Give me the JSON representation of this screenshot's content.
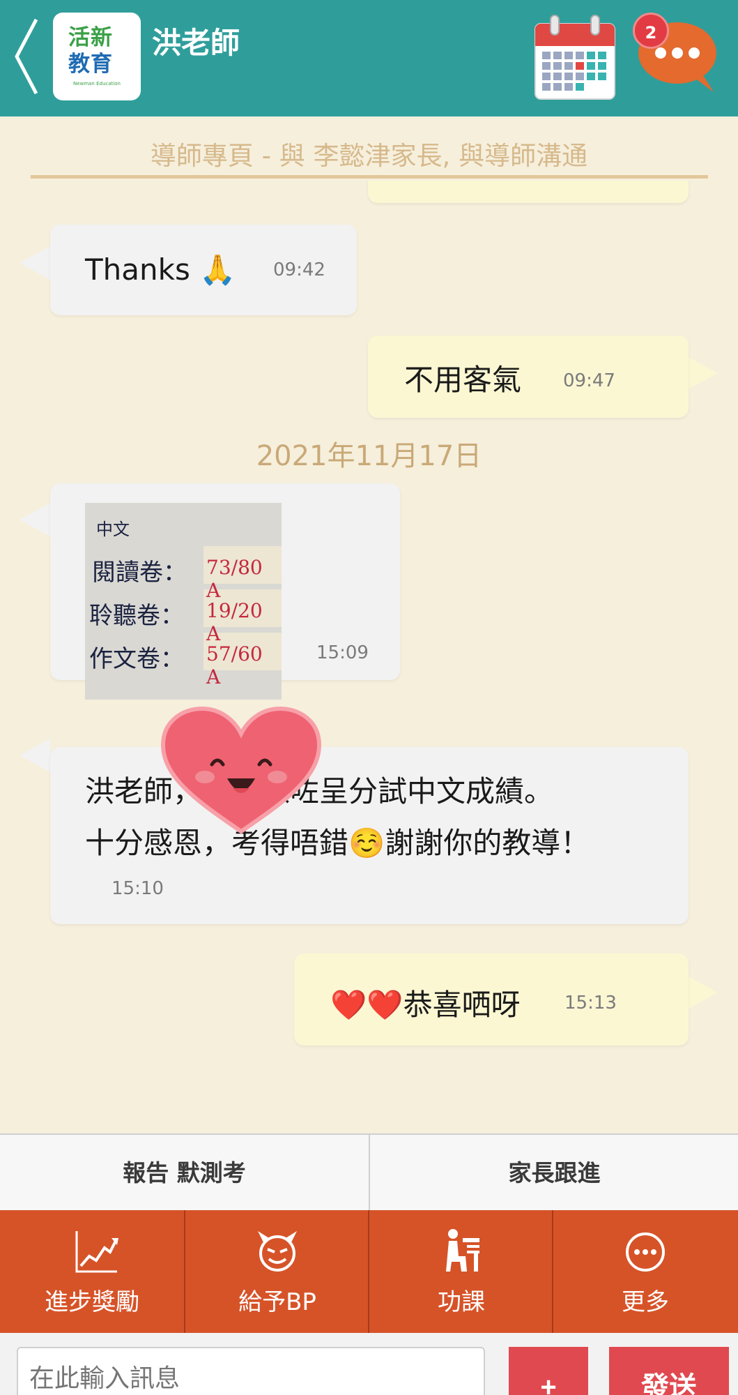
{
  "header": {
    "title": "洪老師",
    "logo_line1": "活新",
    "logo_line2": "教育",
    "logo_caption": "Newman Education",
    "notification_count": "2"
  },
  "subheader": {
    "text": "導師專頁 - 與 李懿津家長, 與導師溝通"
  },
  "messages": [
    {
      "direction": "in",
      "text": "Thanks 🙏",
      "time": "09:42"
    },
    {
      "direction": "out",
      "text": "不用客氣",
      "time": "09:47"
    },
    {
      "direction": "in",
      "type": "image",
      "time": "15:09"
    },
    {
      "direction": "in",
      "line1": "洪老師，今日派咗呈分試中文成績。",
      "line2": "十分感恩，考得唔錯☺️謝謝你的教導！",
      "time": "15:10"
    },
    {
      "direction": "out",
      "text": "❤️❤️恭喜哂呀",
      "time": "15:13"
    }
  ],
  "date_separator": "2021年11月17日",
  "photo": {
    "heading": "中文",
    "rows": [
      {
        "label": "閱讀卷：",
        "score": "73/80 A"
      },
      {
        "label": "聆聽卷：",
        "score": "19/20 A"
      },
      {
        "label": "作文卷：",
        "score": "57/60 A"
      }
    ]
  },
  "tabs": [
    {
      "label": "報告 默測考"
    },
    {
      "label": "家長跟進"
    }
  ],
  "actions": [
    {
      "label": "進步獎勵",
      "icon": "progress-chart-icon"
    },
    {
      "label": "給予BP",
      "icon": "devil-face-icon"
    },
    {
      "label": "功課",
      "icon": "student-desk-icon"
    },
    {
      "label": "更多",
      "icon": "more-dots-icon"
    }
  ],
  "input": {
    "placeholder": "在此輸入訊息",
    "plus_label": "+",
    "send_label": "發送"
  },
  "colors": {
    "header_bg": "#2f9e9b",
    "action_bar_bg": "#d65328",
    "button_red": "#e0494f",
    "incoming_bubble": "#f2f2f2",
    "outgoing_bubble": "#fbf7d3"
  }
}
